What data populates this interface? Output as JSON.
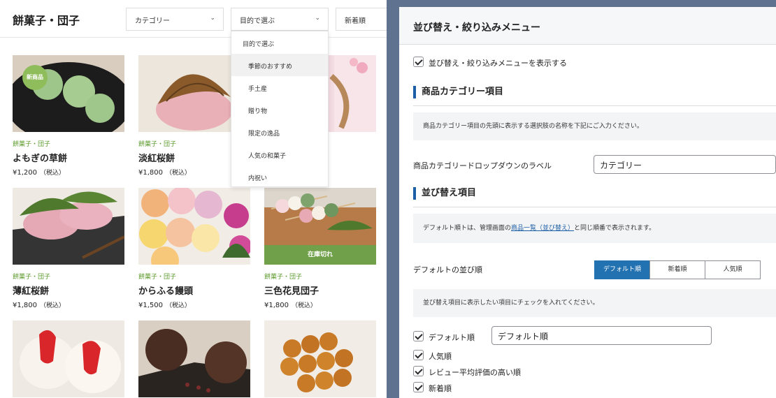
{
  "shop": {
    "title": "餅菓子・団子",
    "selects": {
      "category": "カテゴリー",
      "purpose": "目的で選ぶ",
      "sort": "新着順"
    },
    "purpose_options": [
      "目的で選ぶ",
      "季節のおすすめ",
      "手土産",
      "贈り物",
      "限定の逸品",
      "人気の和菓子",
      "内祝い"
    ],
    "products": [
      {
        "category": "餅菓子・団子",
        "name": "よもぎの草餅",
        "price": "¥1,200",
        "tax": "（税込）",
        "badge": "新商品"
      },
      {
        "category": "餅菓子・団子",
        "name": "淡紅桜餅",
        "price": "¥1,800",
        "tax": "（税込）"
      },
      {
        "category": "餅菓子・団子",
        "name": "薄紅桜餅",
        "price": "¥1,800",
        "tax": "（税込）"
      },
      {
        "category": "餅菓子・団子",
        "name": "からふる饅頭",
        "price": "¥1,500",
        "tax": "（税込）"
      },
      {
        "category": "餅菓子・団子",
        "name": "三色花見団子",
        "price": "¥1,800",
        "tax": "（税込）",
        "status": "在庫切れ"
      }
    ]
  },
  "settings": {
    "title": "並び替え・絞り込みメニュー",
    "show_menu_label": "並び替え・絞り込みメニューを表示する",
    "category_section": {
      "title": "商品カテゴリー項目",
      "info": "商品カテゴリー項目の先頭に表示する選択肢の名称を下記にご入力ください。",
      "dropdown_label": "商品カテゴリードロップダウンのラベル",
      "dropdown_value": "カテゴリー"
    },
    "sort_section": {
      "title": "並び替え項目",
      "info_before": "デフォルト順トは、管理画面の",
      "info_link": "商品一覧（並び替え）",
      "info_after": "と同じ順番で表示されます。",
      "default_label": "デフォルトの並び順",
      "segments": [
        "デフォルト順",
        "新着順",
        "人気順"
      ],
      "check_info": "並び替え項目に表示したい項目にチェックを入れてください。",
      "items": [
        {
          "label": "デフォルト順",
          "value": "デフォルト順"
        },
        {
          "label": "人気順"
        },
        {
          "label": "レビュー平均評価の高い順"
        },
        {
          "label": "新着順"
        }
      ]
    }
  }
}
